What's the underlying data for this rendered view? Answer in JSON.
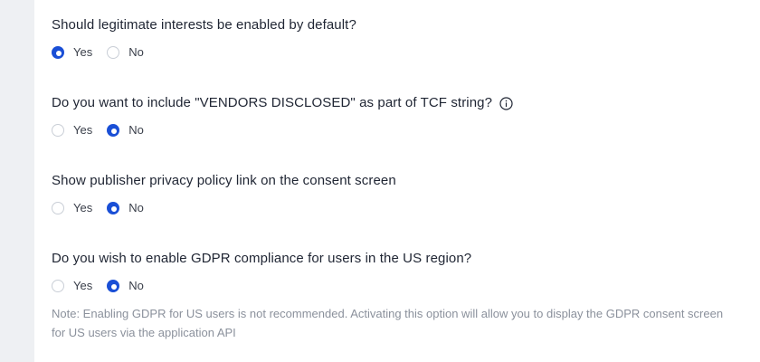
{
  "questions": [
    {
      "text": "Should legitimate interests be enabled by default?",
      "yes_label": "Yes",
      "no_label": "No",
      "selected": "yes"
    },
    {
      "text": "Do you want to include \"VENDORS DISCLOSED\" as part of TCF string?",
      "has_info_icon": true,
      "yes_label": "Yes",
      "no_label": "No",
      "selected": "no"
    },
    {
      "text": "Show publisher privacy policy link on the consent screen",
      "yes_label": "Yes",
      "no_label": "No",
      "selected": "no"
    },
    {
      "text": "Do you wish to enable GDPR compliance for users in the US region?",
      "yes_label": "Yes",
      "no_label": "No",
      "selected": "no",
      "note": "Note: Enabling GDPR for US users is not recommended. Activating this option will allow you to display the GDPR consent screen for US users via the application API"
    }
  ],
  "colors": {
    "accent": "#1a4fd6",
    "page_bg": "#eef0f3",
    "panel_bg": "#ffffff",
    "text": "#1f2533",
    "muted": "#8b919c"
  },
  "icons": {
    "info": "info-circle-icon"
  }
}
